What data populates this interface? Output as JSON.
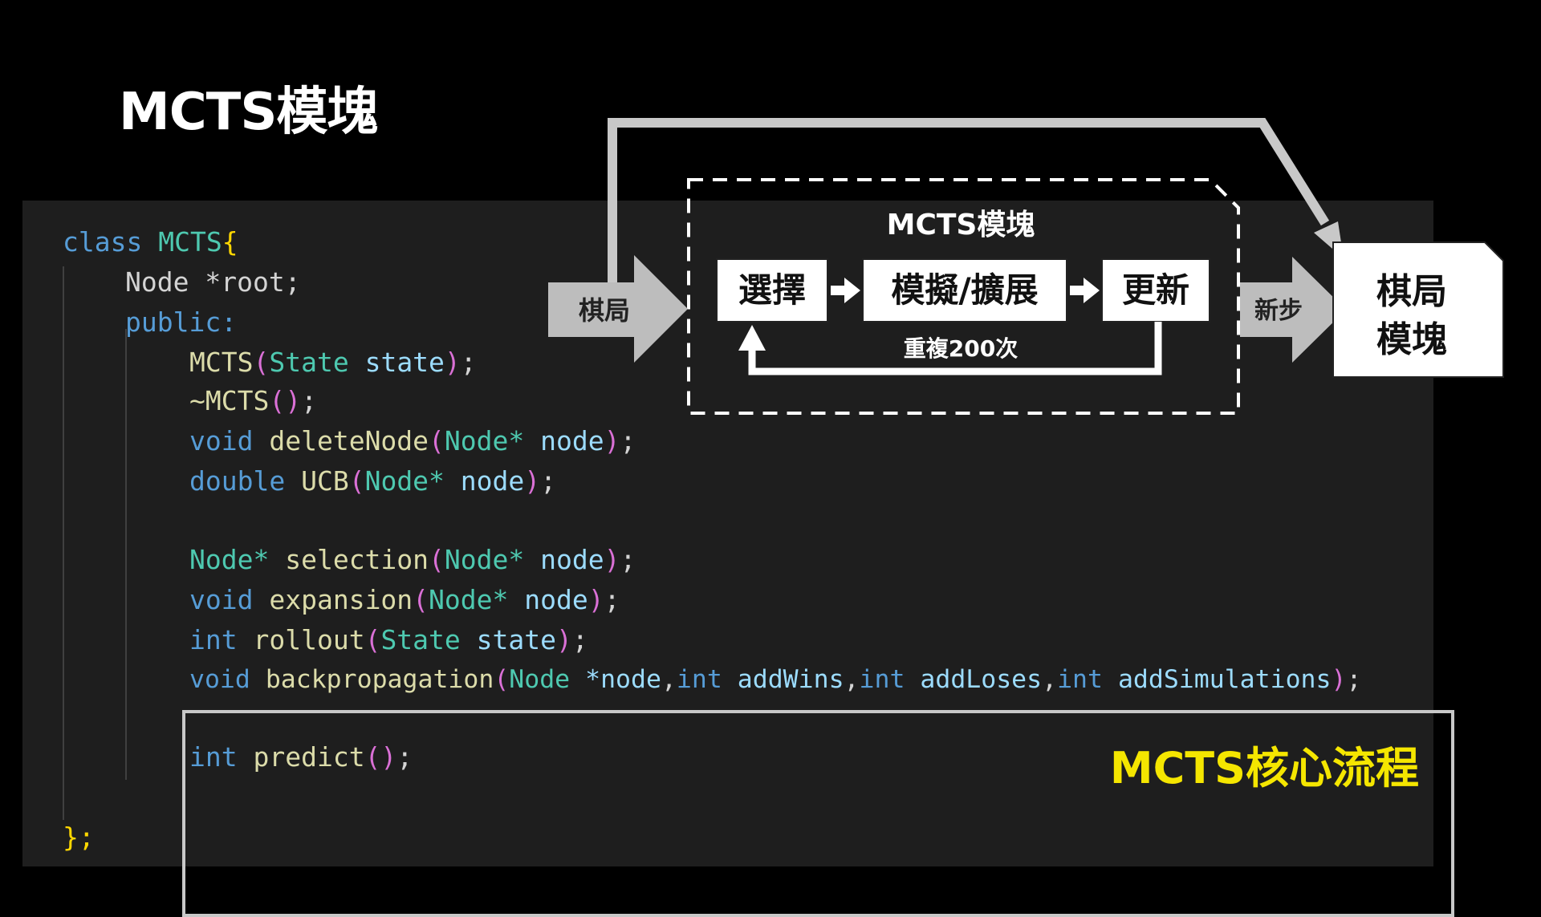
{
  "title": "MCTS模塊",
  "code": {
    "class_kw": "class",
    "class_name": "MCTS",
    "open_brace": "{",
    "root_type": "Node",
    "root_decl": " *root;",
    "public_kw": "public:",
    "ctor_name": "MCTS",
    "ctor_param_type": "State",
    "ctor_param": "state",
    "dtor": "~MCTS",
    "void_kw": "void",
    "double_kw": "double",
    "int_kw": "int",
    "delete_fn": "deleteNode",
    "ucb_fn": "UCB",
    "node_type_ptr": "Node*",
    "node_var": "node",
    "selection_fn": "selection",
    "expansion_fn": "expansion",
    "rollout_fn": "rollout",
    "state_type": "State",
    "state_var": "state",
    "backprop_fn": "backpropagation",
    "node_type": "Node",
    "node_ptr_var": "*node",
    "add_wins": "addWins",
    "add_loses": "addLoses",
    "add_sims": "addSimulations",
    "predict_fn": "predict",
    "close": "};"
  },
  "core_label": "MCTS核心流程",
  "diagram": {
    "module_title": "MCTS模塊",
    "input_label": "棋局",
    "step_select": "選擇",
    "step_simulate": "模擬/擴展",
    "step_update": "更新",
    "repeat_label": "重複200次",
    "output_arrow_label": "新步",
    "output_line1": "棋局",
    "output_line2": "模塊"
  }
}
